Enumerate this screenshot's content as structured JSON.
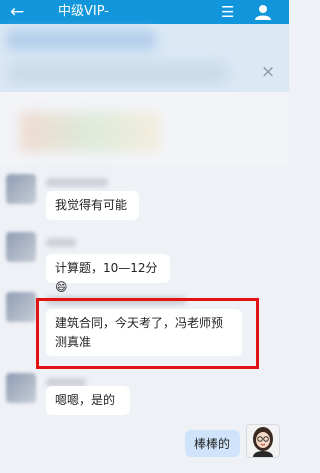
{
  "header": {
    "back_icon": "←",
    "title": "中级VIP-",
    "menu_icon": "☰",
    "group_icon": "person-icon",
    "bg_color": "#1296db"
  },
  "notice": {
    "close_icon": "×"
  },
  "messages": [
    {
      "text": "我觉得有可能",
      "side": "left"
    },
    {
      "text": "计算题，10—12分😄",
      "side": "left"
    },
    {
      "text": "建筑合同，今天考了，冯老师预测真准",
      "side": "left",
      "highlighted": true
    },
    {
      "text": "嗯嗯，是的",
      "side": "left"
    },
    {
      "text": "棒棒的",
      "side": "right"
    }
  ],
  "highlight_color": "#e11313"
}
